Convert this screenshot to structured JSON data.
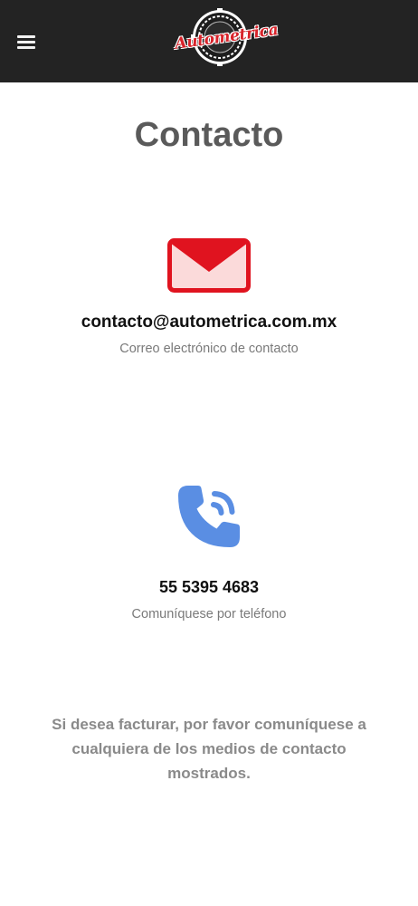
{
  "header": {
    "menu_icon": "hamburger-menu-icon",
    "logo_text": "Autometrica",
    "background": "#232323"
  },
  "page": {
    "title": "Contacto"
  },
  "email_block": {
    "icon": "envelope-icon",
    "icon_color": "#e0131f",
    "address": "contacto@autometrica.com.mx",
    "caption": "Correo electrónico de contacto"
  },
  "phone_block": {
    "icon": "phone-call-icon",
    "icon_color": "#5a8ee3",
    "number": "55 5395 4683",
    "caption": "Comuníquese por teléfono"
  },
  "billing_note": "Si desea facturar, por favor comuníquese a cualquiera de los medios de contacto mostrados."
}
